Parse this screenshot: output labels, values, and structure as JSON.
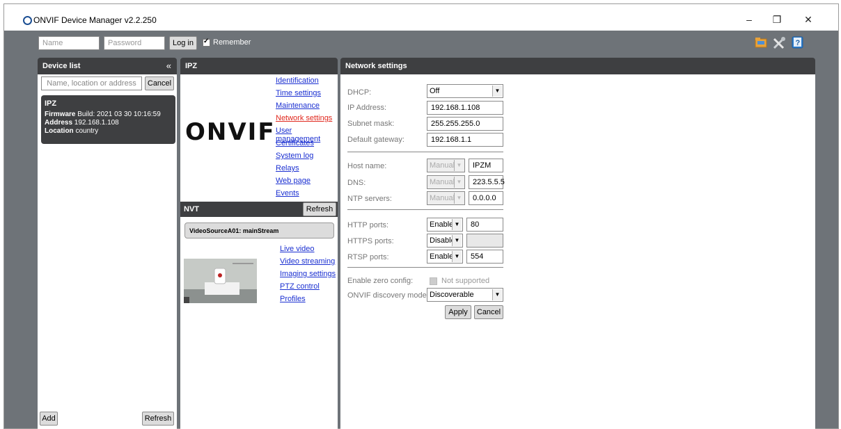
{
  "window": {
    "title": "ONVIF Device Manager v2.2.250",
    "minimize": "–",
    "restore": "❐",
    "close": "✕"
  },
  "login": {
    "name_placeholder": "Name",
    "password_placeholder": "Password",
    "login_label": "Log in",
    "remember_label": "Remember",
    "remember_checked": true
  },
  "toolbar_icons": [
    "folder-icon",
    "tools-icon",
    "help-book-icon"
  ],
  "device_list": {
    "title": "Device list",
    "collapse": "«",
    "search_placeholder": "Name, location or address",
    "cancel_label": "Cancel",
    "device": {
      "name": "IPZ",
      "firmware_label": "Firmware",
      "firmware_value": "Build: 2021 03 30 10:16:59",
      "address_label": "Address",
      "address_value": "192.168.1.108",
      "location_label": "Location",
      "location_value": "country"
    },
    "add_label": "Add",
    "refresh_label": "Refresh"
  },
  "ipz": {
    "title": "IPZ",
    "logo_text": "ONVIF",
    "links": [
      "Identification",
      "Time settings",
      "Maintenance",
      "Network settings",
      "User management",
      "Certificates",
      "System log",
      "Relays",
      "Web page",
      "Events"
    ],
    "active_link": "Network settings",
    "nvt_title": "NVT",
    "nvt_refresh": "Refresh",
    "stream_name": "VideoSourceA01: mainStream",
    "stream_links": [
      "Live video",
      "Video streaming",
      "Imaging settings",
      "PTZ control",
      "Profiles"
    ]
  },
  "network": {
    "title": "Network settings",
    "dhcp_label": "DHCP:",
    "dhcp_value": "Off",
    "ip_label": "IP Address:",
    "ip_value": "192.168.1.108",
    "subnet_label": "Subnet mask:",
    "subnet_value": "255.255.255.0",
    "gateway_label": "Default gateway:",
    "gateway_value": "192.168.1.1",
    "host_label": "Host name:",
    "host_mode": "Manual",
    "host_value": "IPZM",
    "dns_label": "DNS:",
    "dns_mode": "Manual",
    "dns_value": "223.5.5.5",
    "ntp_label": "NTP servers:",
    "ntp_mode": "Manual",
    "ntp_value": "0.0.0.0",
    "http_label": "HTTP ports:",
    "http_mode": "Enable",
    "http_value": "80",
    "https_label": "HTTPS ports:",
    "https_mode": "Disable",
    "https_value": "",
    "rtsp_label": "RTSP ports:",
    "rtsp_mode": "Enable",
    "rtsp_value": "554",
    "zero_label": "Enable zero config:",
    "zero_value": "Not supported",
    "discovery_label": "ONVIF discovery mode:",
    "discovery_value": "Discoverable",
    "apply_label": "Apply",
    "cancel_label": "Cancel"
  }
}
